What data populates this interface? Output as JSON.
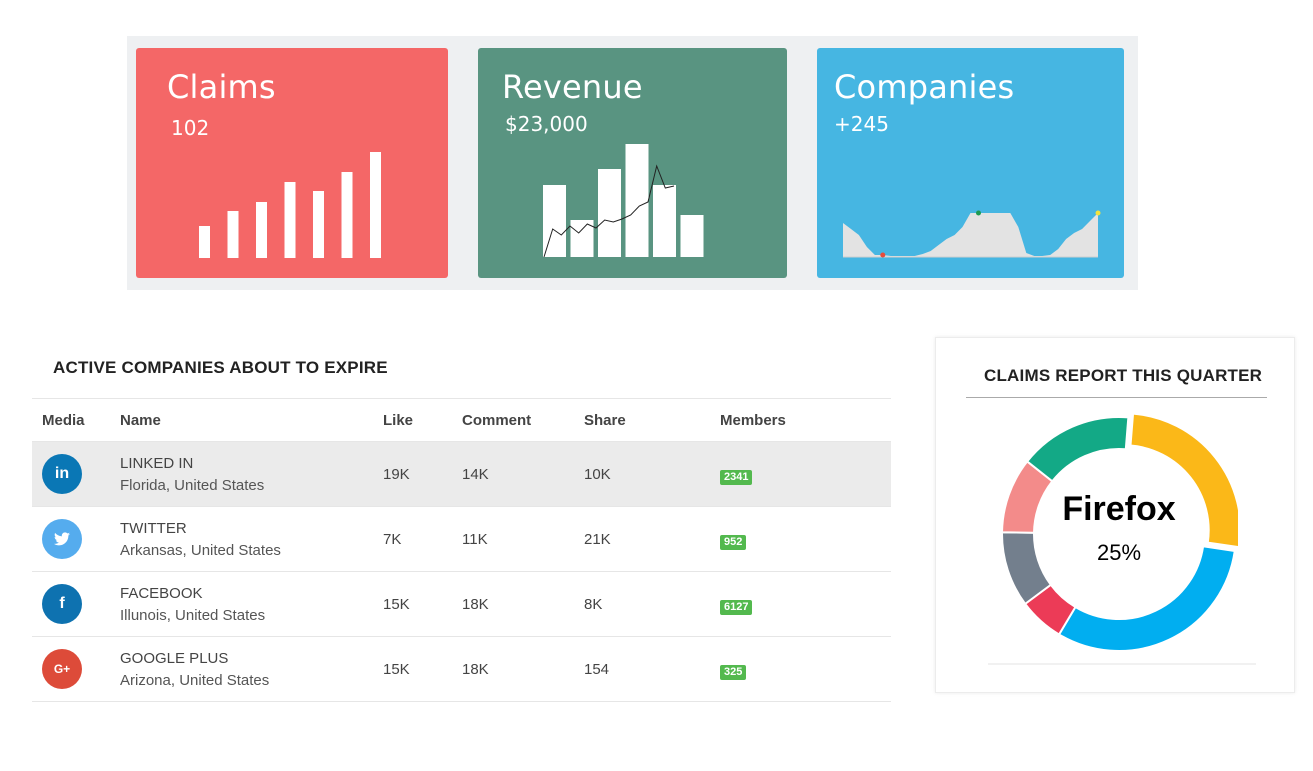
{
  "cards": {
    "claims": {
      "title": "Claims",
      "value": "102",
      "color": "#f46767",
      "bars": [
        32,
        47,
        56,
        76,
        67,
        86,
        106
      ]
    },
    "revenue": {
      "title": "Revenue",
      "value": "$23,000",
      "color": "#599481",
      "bars": [
        72,
        37,
        88,
        113,
        72,
        42
      ],
      "line": [
        0,
        28,
        22,
        31,
        24,
        33,
        29,
        37,
        35,
        38,
        42,
        51,
        55,
        91,
        69,
        71
      ]
    },
    "companies": {
      "title": "Companies",
      "value": "+245",
      "color": "#46b6e2",
      "area": [
        34,
        28,
        22,
        10,
        2,
        2,
        1,
        1,
        1,
        1,
        3,
        6,
        12,
        18,
        22,
        30,
        44,
        44,
        44,
        44,
        44,
        44,
        30,
        4,
        1,
        1,
        2,
        8,
        18,
        24,
        28,
        36,
        44
      ],
      "dot_colors": [
        "#e74c3c",
        "#1e9a52",
        "#f1e33c"
      ]
    }
  },
  "table": {
    "title": "ACTIVE COMPANIES ABOUT TO EXPIRE",
    "headers": {
      "media": "Media",
      "name": "Name",
      "like": "Like",
      "comment": "Comment",
      "share": "Share",
      "members": "Members"
    },
    "rows": [
      {
        "icon": "linkedin-icon",
        "glyph": "in",
        "color": "#0a77b5",
        "name": "LINKED IN",
        "location": "Florida, United States",
        "like": "19K",
        "comment": "14K",
        "share": "10K",
        "members": "2341"
      },
      {
        "icon": "twitter-icon",
        "glyph": "🐦",
        "color": "#55acee",
        "name": "TWITTER",
        "location": "Arkansas, United States",
        "like": "7K",
        "comment": "11K",
        "share": "21K",
        "members": "952"
      },
      {
        "icon": "facebook-icon",
        "glyph": "f",
        "color": "#0e72b0",
        "name": "FACEBOOK",
        "location": "Illunois, United States",
        "like": "15K",
        "comment": "18K",
        "share": "8K",
        "members": "6127"
      },
      {
        "icon": "google-plus-icon",
        "glyph": "G+",
        "color": "#dd4b39",
        "name": "GOOGLE PLUS",
        "location": "Arizona, United States",
        "like": "15K",
        "comment": "18K",
        "share": "154",
        "members": "325"
      }
    ]
  },
  "donut": {
    "title": "CLAIMS REPORT THIS  QUARTER",
    "center_label": "Firefox",
    "center_value": "25%",
    "segments": [
      {
        "value": 25,
        "color": "#fbb818"
      },
      {
        "value": 30,
        "color": "#01aef0"
      },
      {
        "value": 6,
        "color": "#ec3b57"
      },
      {
        "value": 10,
        "color": "#737f8d"
      },
      {
        "value": 10,
        "color": "#f38b8a"
      },
      {
        "value": 15,
        "color": "#13a986"
      }
    ]
  }
}
